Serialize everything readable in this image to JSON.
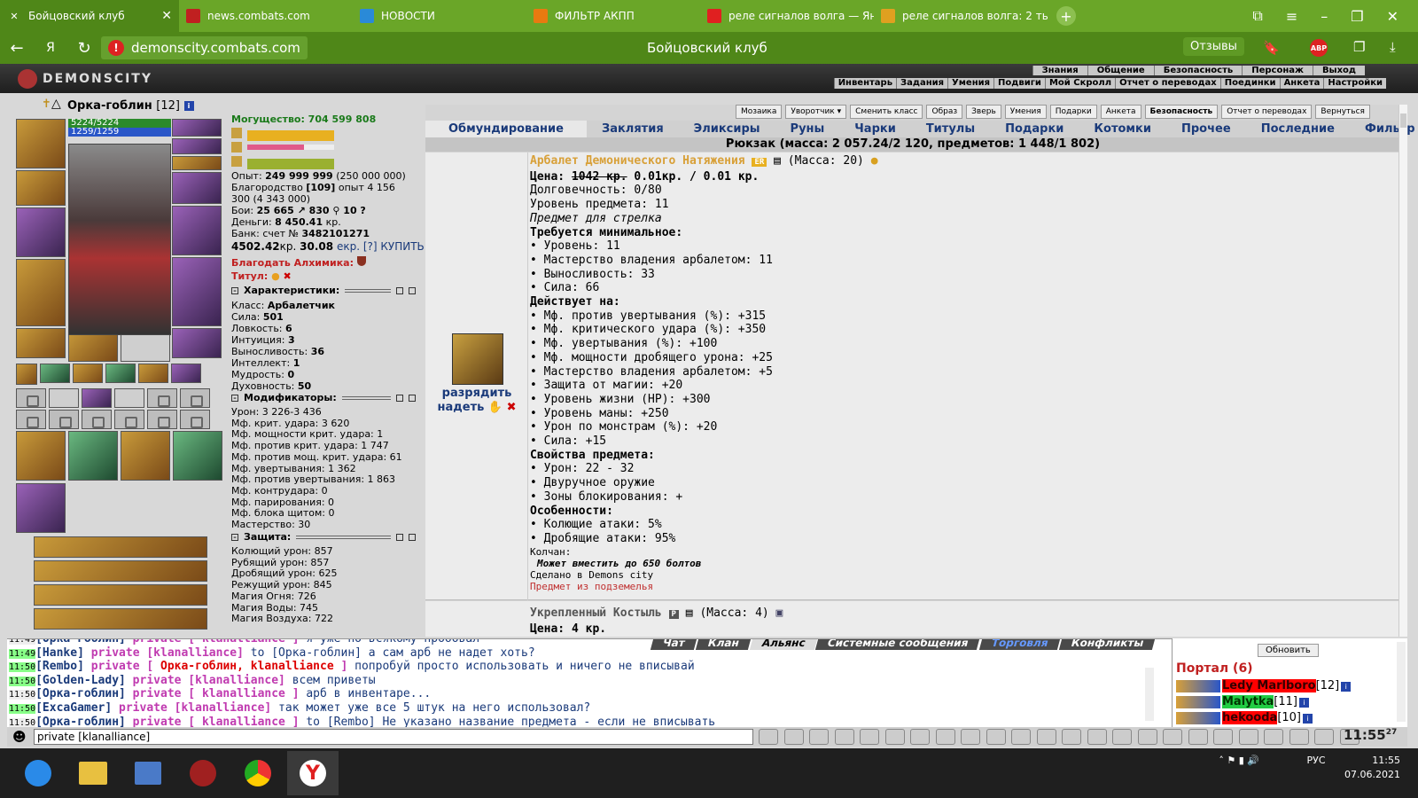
{
  "tabs": [
    {
      "title": "Бойцовский клуб",
      "icon": "x-icon",
      "color": "#ffffff",
      "active": true
    },
    {
      "title": "news.combats.com",
      "icon": "combats-icon",
      "color": "#c02020"
    },
    {
      "title": "НОВОСТИ",
      "icon": "image-icon",
      "color": "#2a8ad8"
    },
    {
      "title": "ФИЛЬТР АКПП",
      "icon": "e-icon",
      "color": "#e87a10"
    },
    {
      "title": "реле сигналов волга — Ян",
      "icon": "yandex-icon",
      "color": "#e02020"
    },
    {
      "title": "реле сигналов волга: 2 ты",
      "icon": "image-icon",
      "color": "#e0a020"
    }
  ],
  "browser": {
    "url": "demonscity.combats.com",
    "title": "Бойцовский клуб",
    "reviews": "Отзывы",
    "abp": "ABP"
  },
  "game": {
    "logo": "DEMONSCITY",
    "menu_top": [
      "Знания",
      "Общение",
      "Безопасность",
      "Персонаж",
      "Выход"
    ],
    "menu_bottom": [
      "Инвентарь",
      "Задания",
      "Умения",
      "Подвиги",
      "Мой Скролл",
      "Отчет о переводах",
      "Поединки",
      "Анкета",
      "Настройки"
    ]
  },
  "char": {
    "name": "Орка-гоблин",
    "level": "[12]",
    "hp": "5224/5224",
    "mp": "1259/1259"
  },
  "stats": {
    "power": "Могущество: 704 599 808",
    "exp": "Опыт: ",
    "exp_val": "249 999 999",
    "exp_rest": " (250 000 000)",
    "nobility": "Благородство ",
    "nobility_val": "[109]",
    "nobility_rest": " опыт 4 156",
    "nobility2": "300 (4 343 000)",
    "fights": "Бои: ",
    "fights_val": "25 665 ↗  830 ⚲  10 ?",
    "money": "Деньги: ",
    "money_val": "8 450.41",
    "money_rest": " кр.",
    "bank": "Банк: счет № ",
    "bank_val": "3482101271",
    "ekr": "4502.42",
    "ekr_rest": "кр. ",
    "ekr_val": "30.08",
    "ekr_rest2": " екр. [?] КУПИТЬ",
    "alchemist": "Благодать Алхимика:",
    "titul": "Титул:"
  },
  "characteristics": {
    "header": "Характеристики:",
    "class_label": "Класс: ",
    "class_val": "Арбалетчик",
    "items": [
      [
        "Сила: ",
        "501"
      ],
      [
        "Ловкость: ",
        "6"
      ],
      [
        "Интуиция: ",
        "3"
      ],
      [
        "Выносливость: ",
        "36"
      ],
      [
        "Интеллект: ",
        "1"
      ],
      [
        "Мудрость: ",
        "0"
      ],
      [
        "Духовность: ",
        "50"
      ]
    ]
  },
  "modifiers": {
    "header": "Модификаторы:",
    "items": [
      "Урон: 3 226-3 436",
      "Мф. крит. удара: 3 620",
      "Мф. мощности крит. удара: 1",
      "Мф. против крит. удара: 1 747",
      "Мф. против мощ. крит. удара: 61",
      "Мф. увертывания: 1 362",
      "Мф. против увертывания: 1 863",
      "Мф. контрудара: 0",
      "Мф. парирования: 0",
      "Мф. блока щитом: 0",
      "Мастерство: 30"
    ]
  },
  "defense": {
    "header": "Защита:",
    "items": [
      "Колющий урон: 857",
      "Рубящий урон: 857",
      "Дробящий урон: 625",
      "Режущий урон: 845",
      "Магия Огня: 726",
      "Магия Воды: 745",
      "Магия Воздуха: 722"
    ]
  },
  "toolbar": [
    "Мозаика",
    "Уворотчик ▾",
    "Сменить класс",
    "Образ",
    "Зверь",
    "Умения",
    "Подарки",
    "Анкета",
    "Безопасность",
    "Отчет о переводах",
    "Вернуться"
  ],
  "categories": [
    "Обмундирование",
    "Заклятия",
    "Эликсиры",
    "Руны",
    "Чарки",
    "Титулы",
    "Подарки",
    "Котомки",
    "Прочее",
    "Последние",
    "Фильтр"
  ],
  "backpack": "Рюкзак (масса: 2 057.24/2 120, предметов: 1 448/1 802)",
  "item": {
    "name": "Арбалет Демонического Натяжения",
    "badge": "ER",
    "mass": " (Масса: 20)",
    "price_label": "Цена: ",
    "price_old": "1042 кр.",
    "price_new": " 0.01кр. / 0.01 кр.",
    "durability": "Долговечность: 0/80",
    "level": "Уровень предмета: 11",
    "for": "Предмет для стрелка",
    "req_header": "Требуется минимальное:",
    "req": [
      "• Уровень: 11",
      "• Мастерство владения арбалетом: 11",
      "• Выносливость: 33",
      "• Сила: 66"
    ],
    "acts_header": "Действует на:",
    "acts": [
      "• Мф. против увертывания (%): +315",
      "• Мф. критического удара (%): +350",
      "• Мф. увертывания (%): +100",
      "• Мф. мощности дробящего урона: +25",
      "• Мастерство владения арбалетом: +5",
      "• Защита от магии: +20",
      "• Уровень жизни (HP): +300",
      "• Уровень маны: +250",
      "• Урон по монстрам (%): +20",
      "• Сила: +15"
    ],
    "props_header": "Свойства предмета:",
    "props": [
      "• Урон: 22 - 32",
      "• Двуручное оружие",
      "• Зоны блокирования: +"
    ],
    "feat_header": "Особенности:",
    "feat": [
      "• Колющие атаки: 5%",
      "• Дробящие атаки: 95%"
    ],
    "quiver": "Колчан:",
    "quiver_text": "Может вместить до 650 болтов",
    "made": "Сделано в Demons city",
    "underground": "Предмет из подземелья",
    "act1": "разрядить",
    "act2": "надеть"
  },
  "item2": {
    "name": "Укрепленный Костыль",
    "badge": "P",
    "mass": " (Масса: 4)",
    "price": "Цена: 4 кр."
  },
  "chat": {
    "tabs": [
      "Чат",
      "Клан",
      "Альянс",
      "Системные сообщения",
      "Торговля",
      "Конфликты"
    ],
    "lines": [
      {
        "t": "11:49",
        "g": false,
        "nick": "[Орка-гоблин]",
        "priv": " private [ klanalliance ]",
        "msg": " я уже по всякому пробовал"
      },
      {
        "t": "11:49",
        "g": true,
        "nick": "[Hanke]",
        "priv": " private [klanalliance]",
        "msg": " to [Орка-гоблин] а сам арб не надет хоть?"
      },
      {
        "t": "11:50",
        "g": true,
        "nick": "[Rembo]",
        "priv": " private [ ",
        "red": "Орка-гоблин, klanalliance",
        "priv2": " ]",
        "msg": " попробуй просто использовать и ничего не вписывай"
      },
      {
        "t": "11:50",
        "g": true,
        "nick": "[Golden-Lady]",
        "priv": " private [klanalliance]",
        "msg": " всем приветы"
      },
      {
        "t": "11:50",
        "g": false,
        "nick": "[Орка-гоблин]",
        "priv": " private [ klanalliance ]",
        "msg": " арб в инвентаре..."
      },
      {
        "t": "11:50",
        "g": true,
        "nick": "[ExcaGamer]",
        "priv": " private [klanalliance]",
        "msg": " так может уже все 5 штук на него использовал?"
      },
      {
        "t": "11:50",
        "g": false,
        "nick": "[Орка-гоблин]",
        "priv": " private [ klanalliance ]",
        "msg": " to [Rembo] Не указано название предмета - если не вписывать"
      }
    ],
    "input": "private [klanalliance]"
  },
  "online": {
    "refresh": "Обновить",
    "portal": "Портал (6)",
    "users": [
      {
        "name": "Ledy Marlboro",
        "lvl": "[12]",
        "c": "rn"
      },
      {
        "name": "Malytka",
        "lvl": "[11]",
        "c": "gn"
      },
      {
        "name": "hekooda",
        "lvl": "[10]",
        "c": "rn"
      }
    ]
  },
  "clock": {
    "time": "11:55",
    "sec": "27"
  },
  "tray": {
    "lang": "РУС",
    "time": "11:55",
    "date": "07.06.2021"
  }
}
